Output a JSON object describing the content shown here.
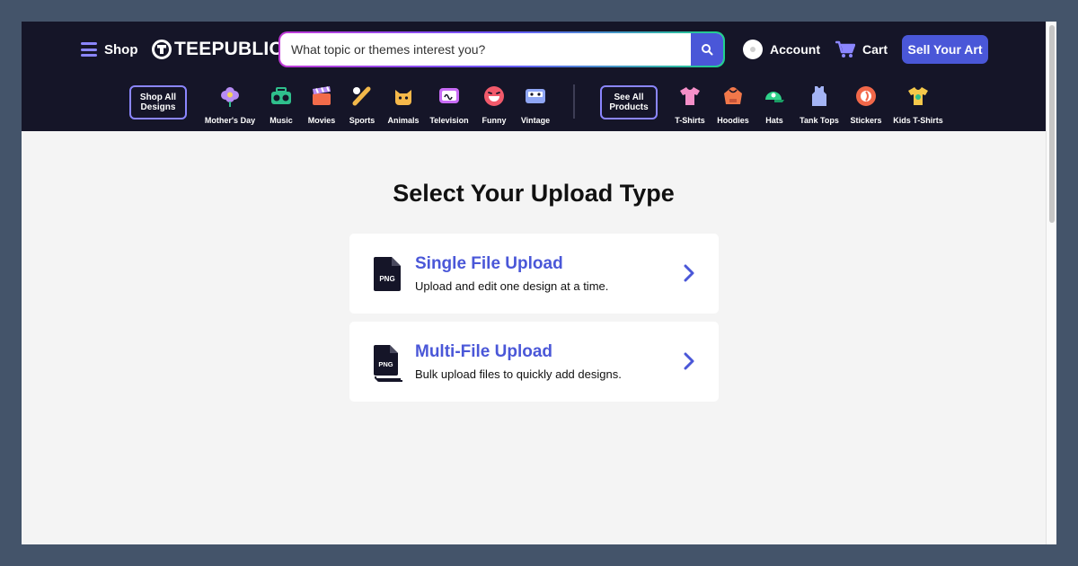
{
  "header": {
    "shop_label": "Shop",
    "logo_text": "TEEPUBLIC",
    "search_placeholder": "What topic or themes interest you?",
    "account_label": "Account",
    "cart_label": "Cart",
    "sell_label": "Sell Your Art"
  },
  "nav": {
    "shop_all": [
      "Shop All",
      "Designs"
    ],
    "topics": [
      {
        "label": "Mother's Day",
        "icon": "flower-icon",
        "color": "#b78cf5"
      },
      {
        "label": "Music",
        "icon": "boombox-icon",
        "color": "#2fbf8c"
      },
      {
        "label": "Movies",
        "icon": "clapperboard-icon",
        "color": "#f26b4a"
      },
      {
        "label": "Sports",
        "icon": "baseball-bat-icon",
        "color": "#f2b84a"
      },
      {
        "label": "Animals",
        "icon": "cat-icon",
        "color": "#f5b84a"
      },
      {
        "label": "Television",
        "icon": "tv-icon",
        "color": "#c86bf5"
      },
      {
        "label": "Funny",
        "icon": "laughing-face-icon",
        "color": "#f25a6b"
      },
      {
        "label": "Vintage",
        "icon": "cassette-icon",
        "color": "#8fa6f5"
      }
    ],
    "see_all": [
      "See All",
      "Products"
    ],
    "products": [
      {
        "label": "T-Shirts",
        "icon": "tshirt-icon",
        "color": "#f58fc8"
      },
      {
        "label": "Hoodies",
        "icon": "hoodie-icon",
        "color": "#f2784a"
      },
      {
        "label": "Hats",
        "icon": "cap-icon",
        "color": "#2fd18a"
      },
      {
        "label": "Tank Tops",
        "icon": "tank-top-icon",
        "color": "#a4b4f5"
      },
      {
        "label": "Stickers",
        "icon": "sticker-icon",
        "color": "#f2684a"
      },
      {
        "label": "Kids T-Shirts",
        "icon": "kids-tshirt-icon",
        "color": "#f5c84a"
      }
    ]
  },
  "main": {
    "title": "Select Your Upload Type",
    "options": [
      {
        "title": "Single File Upload",
        "description": "Upload and edit one design at a time.",
        "icon": "png-file-icon",
        "badge": "PNG"
      },
      {
        "title": "Multi-File Upload",
        "description": "Bulk upload files to quickly add designs.",
        "icon": "png-files-stack-icon",
        "badge": "PNG"
      }
    ]
  },
  "colors": {
    "header_bg": "#151528",
    "accent": "#4a57d8",
    "nav_outline": "#8b86ff",
    "page_bg": "#f4f4f4"
  }
}
